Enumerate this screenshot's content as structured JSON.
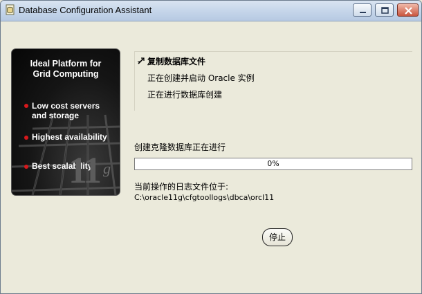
{
  "window": {
    "title": "Database Configuration Assistant",
    "icon": "dbca-app-icon"
  },
  "banner": {
    "title_line1": "Ideal Platform for",
    "title_line2": "Grid Computing",
    "bullets": [
      {
        "line1": "Low cost servers",
        "line2": "and storage"
      },
      {
        "line1": "Highest availability",
        "line2": ""
      },
      {
        "line1": "Best scalability",
        "line2": ""
      }
    ],
    "logo_number": "11",
    "logo_letter": "g",
    "bullet_color": "#d8181c"
  },
  "steps": [
    {
      "label": "复制数据库文件",
      "state": "current",
      "icon": "in-progress-arrow-icon"
    },
    {
      "label": "正在创建并启动 Oracle 实例",
      "state": "pending"
    },
    {
      "label": "正在进行数据库创建",
      "state": "pending"
    }
  ],
  "progress": {
    "label": "创建克隆数据库正在进行",
    "percent_text": "0%",
    "fraction": 0.0
  },
  "log": {
    "label": "当前操作的日志文件位于:",
    "path": "C:\\oracle11g\\cfgtoollogs\\dbca\\orcl11"
  },
  "buttons": {
    "stop_label": "停止"
  }
}
